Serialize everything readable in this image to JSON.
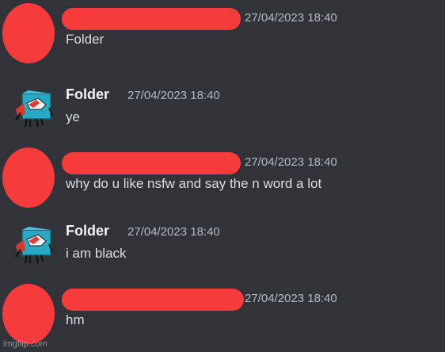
{
  "messages": [
    {
      "author": "",
      "author_redacted": true,
      "timestamp": "27/04/2023 18:40",
      "text": "Folder"
    },
    {
      "author": "Folder",
      "author_redacted": false,
      "timestamp": "27/04/2023 18:40",
      "text": "ye"
    },
    {
      "author": "",
      "author_redacted": true,
      "timestamp": "27/04/2023 18:40",
      "text": "why do u like nsfw and say the n word a lot"
    },
    {
      "author": "Folder",
      "author_redacted": false,
      "timestamp": "27/04/2023 18:40",
      "text": "i am black"
    },
    {
      "author": "",
      "author_redacted": true,
      "timestamp": "27/04/2023 18:40",
      "text": "hm"
    }
  ],
  "watermark": "imgflip.com",
  "colors": {
    "background": "#313338",
    "redaction": "#f53b3b",
    "username": "#f2f3f5",
    "message_text": "#dbdee1",
    "timestamp": "#b5bac1"
  },
  "icons": {
    "redacted_avatar": "red-scribble-avatar-icon",
    "folder_avatar": "folder-character-avatar-icon"
  }
}
